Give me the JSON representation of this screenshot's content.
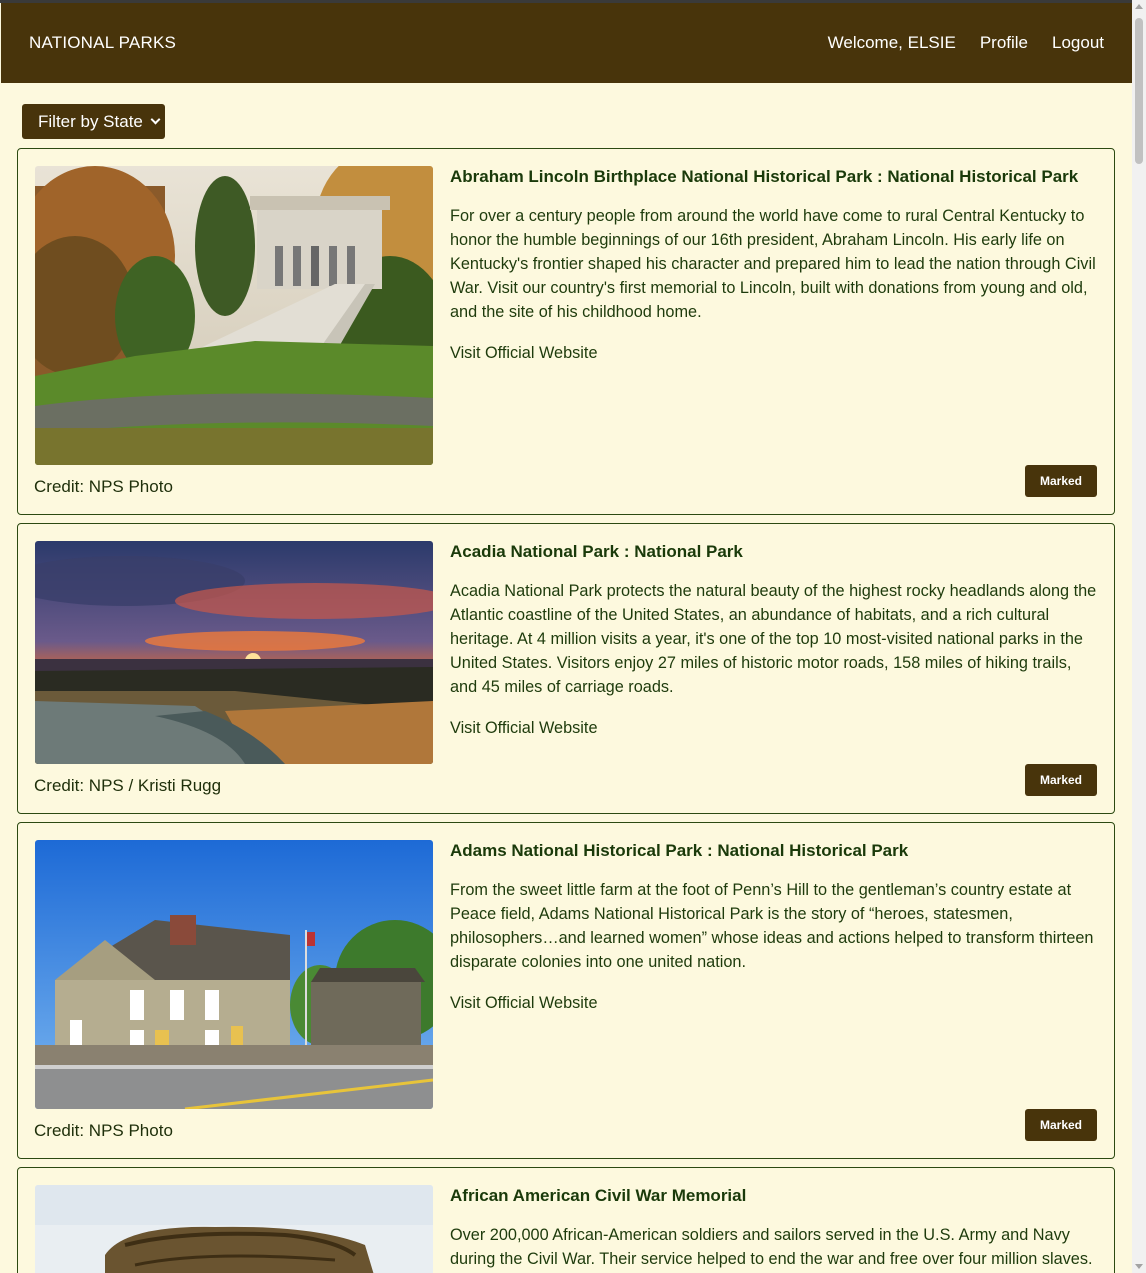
{
  "navbar": {
    "brand": "NATIONAL PARKS",
    "welcome": "Welcome, ELSIE",
    "profile": "Profile",
    "logout": "Logout"
  },
  "filter": {
    "selected": "Filter by State"
  },
  "parks": [
    {
      "title": "Abraham Lincoln Birthplace National Historical Park : National Historical Park",
      "description": "For over a century people from around the world have come to rural Central Kentucky to honor the humble beginnings of our 16th president, Abraham Lincoln. His early life on Kentucky's frontier shaped his character and prepared him to lead the nation through Civil War. Visit our country's first memorial to Lincoln, built with donations from young and old, and the site of his childhood home.",
      "link": "Visit Official Website",
      "credit": "Credit: NPS Photo",
      "button": "Marked"
    },
    {
      "title": "Acadia National Park : National Park",
      "description": "Acadia National Park protects the natural beauty of the highest rocky headlands along the Atlantic coastline of the United States, an abundance of habitats, and a rich cultural heritage. At 4 million visits a year, it's one of the top 10 most-visited national parks in the United States. Visitors enjoy 27 miles of historic motor roads, 158 miles of hiking trails, and 45 miles of carriage roads.",
      "link": "Visit Official Website",
      "credit": "Credit: NPS / Kristi Rugg",
      "button": "Marked"
    },
    {
      "title": "Adams National Historical Park : National Historical Park",
      "description": "From the sweet little farm at the foot of Penn’s Hill to the gentleman’s country estate at Peace field, Adams National Historical Park is the story of “heroes, statesmen, philosophers…and learned women” whose ideas and actions helped to transform thirteen disparate colonies into one united nation.",
      "link": "Visit Official Website",
      "credit": "Credit: NPS Photo",
      "button": "Marked"
    },
    {
      "title": "African American Civil War Memorial",
      "description": "Over 200,000 African-American soldiers and sailors served in the U.S. Army and Navy during the Civil War. Their service helped to end the war and free over four million slaves."
    }
  ],
  "colors": {
    "brand_brown": "#48340b",
    "page_bg": "#fdf9de",
    "text_green": "#1e3b0c"
  }
}
